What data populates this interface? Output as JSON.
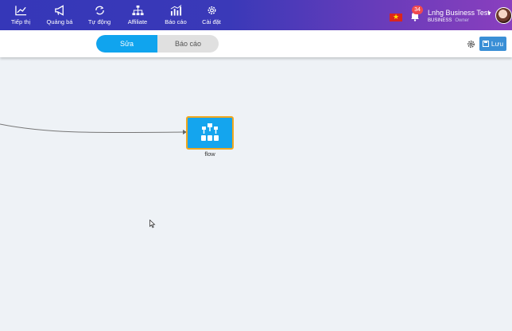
{
  "nav": {
    "items": [
      {
        "label": "Tiếp thị",
        "icon": "chart-line-icon"
      },
      {
        "label": "Quảng bá",
        "icon": "megaphone-icon"
      },
      {
        "label": "Tự động",
        "icon": "refresh-icon"
      },
      {
        "label": "Affiliate",
        "icon": "network-icon"
      },
      {
        "label": "Báo cáo",
        "icon": "bar-chart-icon"
      },
      {
        "label": "Cài đặt",
        "icon": "gear-icon"
      }
    ]
  },
  "notifications": {
    "count": "34"
  },
  "user": {
    "name": "Lnhg Business Test",
    "plan": "BUSINESS",
    "role": "Owner"
  },
  "toolbar": {
    "tab_edit": "Sửa",
    "tab_report": "Báo cáo",
    "save_label": "Lưu"
  },
  "canvas": {
    "node_label": "flow"
  },
  "colors": {
    "accent": "#10a4ee",
    "node_border": "#f0a81f",
    "save": "#3a8fd6",
    "badge": "#f0494f"
  }
}
